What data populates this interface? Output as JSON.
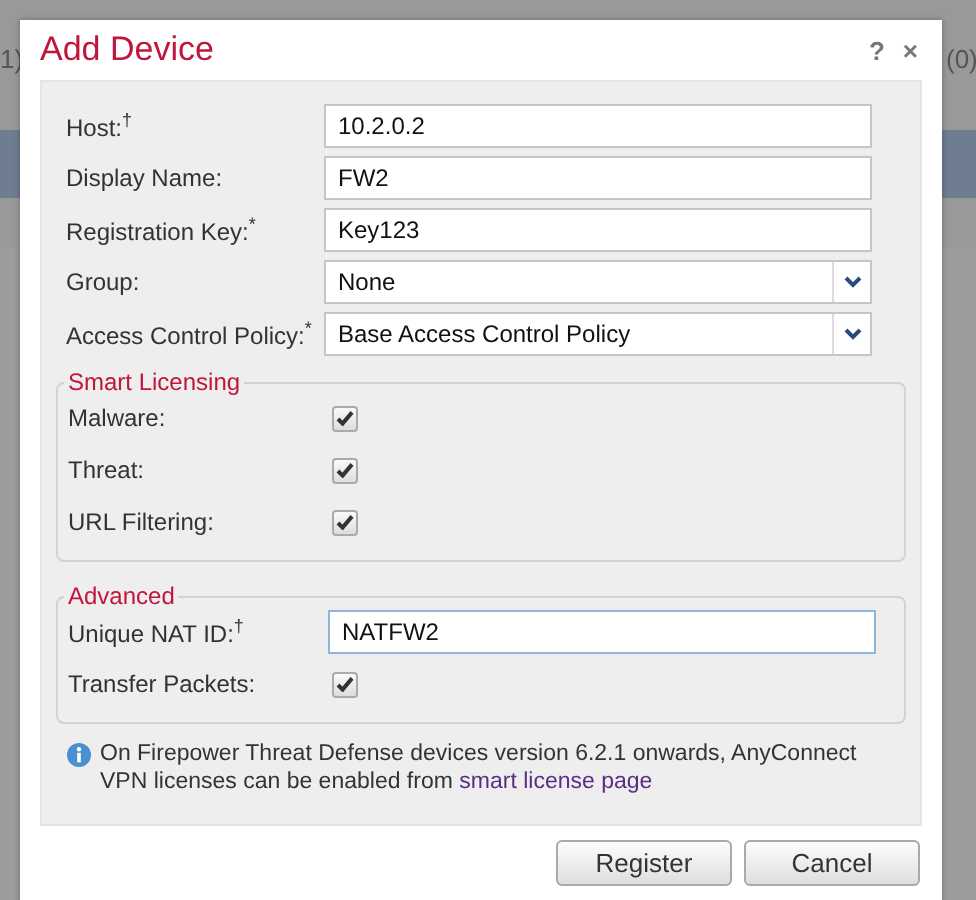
{
  "background": {
    "left_text": "1)",
    "right_text": "(0)"
  },
  "dialog": {
    "title": "Add Device",
    "help": "?",
    "close": "×"
  },
  "fields": [
    {
      "kind": "text",
      "label": "Host:$^{†}$",
      "value": "10.2.0.2",
      "focused": false
    },
    {
      "kind": "text",
      "label": "Display Name:",
      "value": "FW2",
      "focused": false
    },
    {
      "kind": "text",
      "label": "Registration Key:$^{*}$",
      "value": "Key123",
      "focused": false
    },
    {
      "kind": "select",
      "label": "Group:",
      "value": "None"
    },
    {
      "kind": "select",
      "label": "Access Control Policy:$^{*}$",
      "value": "Base Access Control Policy"
    }
  ],
  "fieldsets": [
    {
      "legend": "Smart Licensing",
      "rows": [
        {
          "kind": "checkbox",
          "label": "Malware:",
          "checked": true
        },
        {
          "kind": "checkbox",
          "label": "Threat:",
          "checked": true
        },
        {
          "kind": "checkbox",
          "label": "URL Filtering:",
          "checked": true
        }
      ]
    },
    {
      "legend": "Advanced",
      "rows": [
        {
          "kind": "text",
          "label": "Unique NAT ID:$^{†}$",
          "value": "NATFW2",
          "focused": true
        },
        {
          "kind": "checkbox",
          "label": "Transfer Packets:",
          "checked": true
        }
      ]
    }
  ],
  "info": {
    "text": "On Firepower Threat Defense devices version 6.2.1 onwards, AnyConnect VPN licenses can be enabled from ",
    "link": "smart license page"
  },
  "buttons": [
    {
      "label": "Register"
    },
    {
      "label": "Cancel"
    }
  ]
}
